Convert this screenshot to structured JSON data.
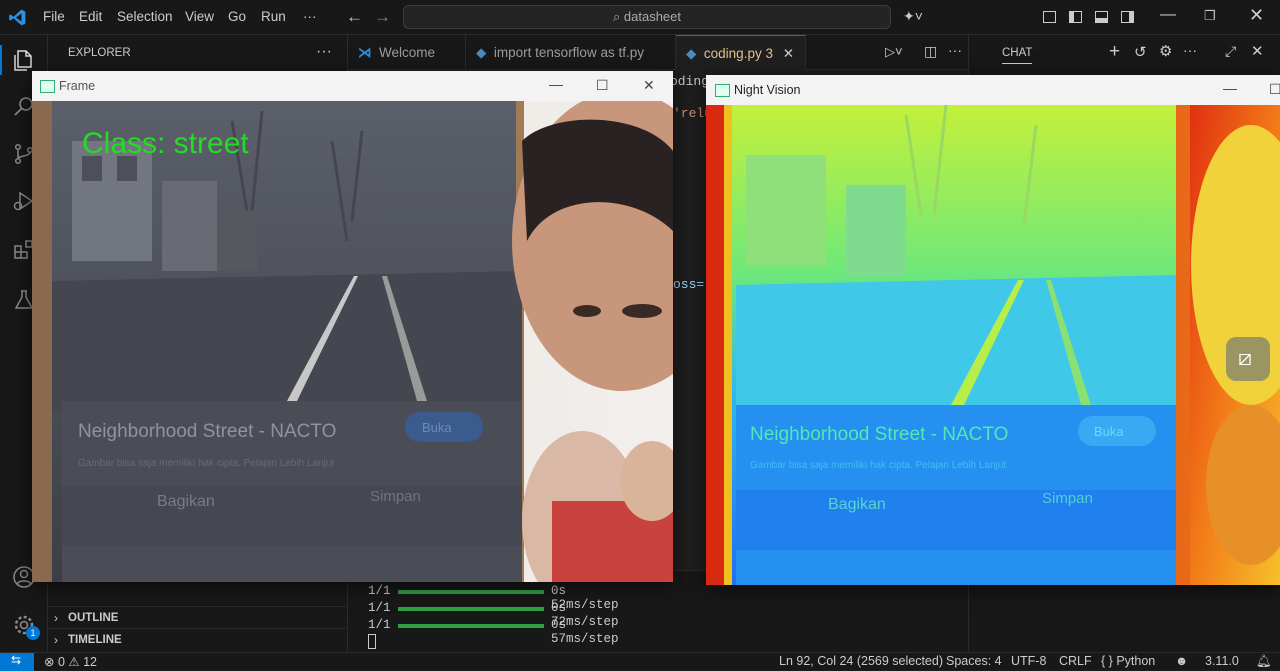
{
  "menu": [
    "File",
    "Edit",
    "Selection",
    "View",
    "Go",
    "Run",
    "···"
  ],
  "command_center": {
    "text": "datasheet"
  },
  "sidebar": {
    "title": "EXPLORER",
    "outline": "OUTLINE",
    "timeline": "TIMELINE"
  },
  "tabs": [
    {
      "label": "Welcome",
      "icon": "vscode-icon"
    },
    {
      "label": "import tensorflow as tf.py",
      "icon": "python-icon"
    },
    {
      "label": "coding.py",
      "badge": "3",
      "icon": "python-icon",
      "active": true
    }
  ],
  "editor_fragments": {
    "f1": "oding",
    "f2": "'relu",
    "f3": "oss="
  },
  "terminal": {
    "lines": [
      {
        "step": "1/1",
        "time": "0s 52ms/step"
      },
      {
        "step": "1/1",
        "time": "0s 72ms/step"
      },
      {
        "step": "1/1",
        "time": "0s 57ms/step"
      }
    ]
  },
  "chat": {
    "title": "CHAT"
  },
  "frame_window": {
    "title": "Frame",
    "overlay": "Class: street",
    "phone": {
      "headline": "Neighborhood Street - NACTO",
      "button": "Buka",
      "caption": "Gambar bisa saja memiliki hak cipta. Pelajari Lebih Lanjut",
      "share": "Bagikan",
      "save": "Simpan"
    }
  },
  "night_window": {
    "title": "Night Vision",
    "phone": {
      "headline": "Neighborhood Street - NACTO",
      "button": "Buka",
      "caption": "Gambar bisa saja memiliki hak cipta. Pelajari Lebih Lanjut",
      "share": "Bagikan",
      "save": "Simpan"
    }
  },
  "accounts_badge": "1",
  "status": {
    "errors": "0",
    "warnings": "12",
    "position": "Ln 92, Col 24 (2569 selected)",
    "spaces": "Spaces: 4",
    "encoding": "UTF-8",
    "eol": "CRLF",
    "language": "Python",
    "version": "3.11.0",
    "language_braces": "{ }"
  },
  "colors": {
    "accent": "#0078d4",
    "overlay_text": "#22dd22",
    "active_tab_text": "#e2c08d",
    "progress": "#2ea043"
  }
}
